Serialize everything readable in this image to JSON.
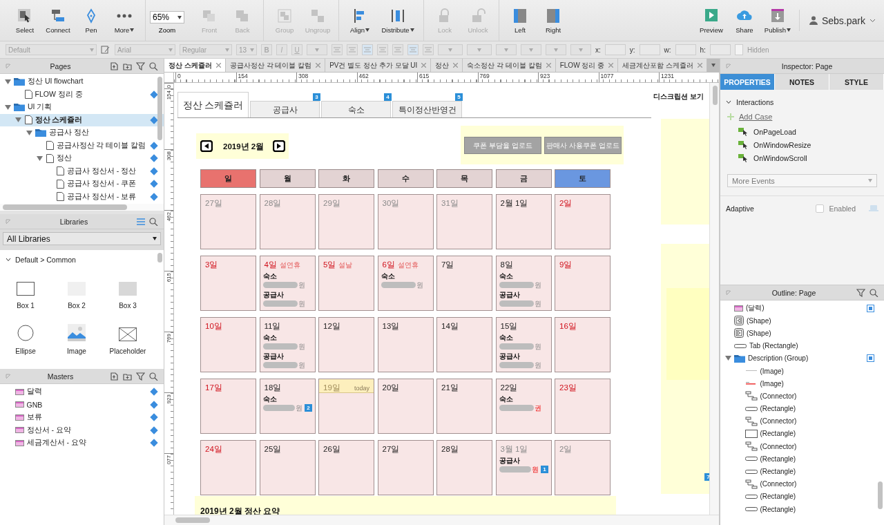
{
  "toolbar": {
    "left": [
      {
        "kind": "select",
        "label": "Select",
        "disabled": false,
        "menu": false
      },
      {
        "kind": "connect",
        "label": "Connect",
        "disabled": false,
        "menu": false
      },
      {
        "kind": "pen",
        "label": "Pen",
        "disabled": false,
        "menu": false
      },
      {
        "kind": "more",
        "label": "More",
        "disabled": false,
        "menu": true
      }
    ],
    "zoom": {
      "label": "Zoom",
      "value": "65%"
    },
    "middle": [
      {
        "kind": "front",
        "label": "Front",
        "disabled": true,
        "menu": false
      },
      {
        "kind": "back",
        "label": "Back",
        "disabled": true,
        "menu": false
      },
      {
        "kind": "group",
        "label": "Group",
        "disabled": true,
        "menu": false
      },
      {
        "kind": "ungroup",
        "label": "Ungroup",
        "disabled": true,
        "menu": false
      },
      {
        "kind": "align",
        "label": "Align",
        "disabled": false,
        "menu": true
      },
      {
        "kind": "distribute",
        "label": "Distribute",
        "disabled": false,
        "menu": true
      },
      {
        "kind": "lock",
        "label": "Lock",
        "disabled": true,
        "menu": false
      },
      {
        "kind": "unlock",
        "label": "Unlock",
        "disabled": true,
        "menu": false
      },
      {
        "kind": "left",
        "label": "Left",
        "disabled": false,
        "menu": false
      },
      {
        "kind": "right",
        "label": "Right",
        "disabled": false,
        "menu": false
      }
    ],
    "right": [
      {
        "kind": "preview",
        "label": "Preview",
        "disabled": false,
        "menu": false
      },
      {
        "kind": "share",
        "label": "Share",
        "disabled": false,
        "menu": false
      },
      {
        "kind": "publish",
        "label": "Publish",
        "disabled": false,
        "menu": true
      }
    ],
    "user": "Sebs.park"
  },
  "format_bar": {
    "style": "Default",
    "font": "Arial",
    "weight": "Regular",
    "size": "13",
    "marks": [
      "B",
      "I",
      "U"
    ],
    "coords": [
      "x:",
      "y:",
      "w:",
      "h:"
    ],
    "hidden": {
      "label": "Hidden",
      "checked": false
    }
  },
  "pages": {
    "title": "Pages",
    "items": [
      {
        "label": "정산 UI flowchart",
        "kind": "folder",
        "selected": false,
        "annotated": false,
        "expanded": true,
        "children": [
          {
            "label": "FLOW 정리 중",
            "kind": "page",
            "selected": false,
            "annotated": true
          }
        ]
      },
      {
        "label": "UI 기획",
        "kind": "folder",
        "selected": false,
        "annotated": false,
        "expanded": true,
        "children": [
          {
            "label": "정산 스케쥴러",
            "kind": "page",
            "selected": true,
            "annotated": true,
            "expanded": true,
            "children": [
              {
                "label": "공급사 정산",
                "kind": "folder",
                "selected": false,
                "annotated": false,
                "expanded": true,
                "children": [
                  {
                    "label": "공급사정산 각 테이블 칼럼",
                    "kind": "page",
                    "selected": false,
                    "annotated": true
                  },
                  {
                    "label": "정산",
                    "kind": "page",
                    "selected": false,
                    "annotated": true,
                    "expanded": true,
                    "children": [
                      {
                        "label": "공급사 정산서 - 정산",
                        "kind": "page",
                        "selected": false,
                        "annotated": true
                      },
                      {
                        "label": "공급사 정산서 - 쿠폰",
                        "kind": "page",
                        "selected": false,
                        "annotated": true
                      },
                      {
                        "label": "공급사 정산서 - 보류",
                        "kind": "page",
                        "selected": false,
                        "annotated": true
                      }
                    ]
                  }
                ]
              }
            ]
          }
        ]
      }
    ]
  },
  "libraries": {
    "title": "Libraries",
    "filter": "All Libraries",
    "section": "Default > Common",
    "widgets": [
      {
        "kind": "box1",
        "label": "Box 1"
      },
      {
        "kind": "box2",
        "label": "Box 2"
      },
      {
        "kind": "box3",
        "label": "Box 3"
      },
      {
        "kind": "ellipse",
        "label": "Ellipse"
      },
      {
        "kind": "image",
        "label": "Image"
      },
      {
        "kind": "placeholder",
        "label": "Placeholder"
      }
    ]
  },
  "masters": {
    "title": "Masters",
    "items": [
      {
        "label": "달력",
        "annotated": true
      },
      {
        "label": "GNB",
        "annotated": true
      },
      {
        "label": "보류",
        "annotated": true
      },
      {
        "label": "정산서 - 요약",
        "annotated": true
      },
      {
        "label": "세금계산서 - 요약",
        "annotated": true
      }
    ]
  },
  "doc_tabs": [
    {
      "label": "정산 스케쥴러",
      "selected": true
    },
    {
      "label": "공급사정산 각 테이블 칼럼",
      "selected": false
    },
    {
      "label": "PV건 별도 정산 추가 모달 UI",
      "selected": false
    },
    {
      "label": "정산",
      "selected": false
    },
    {
      "label": "숙소정산 각 테이블 칼럼",
      "selected": false
    },
    {
      "label": "FLOW 정리 중",
      "selected": false
    },
    {
      "label": "세금계산포함 스케쥴러",
      "selected": false
    }
  ],
  "ruler": {
    "horizontal": [
      "0",
      "154",
      "308",
      "462",
      "615",
      "769",
      "923",
      "1077",
      "1231"
    ],
    "vertical": [
      "0",
      "154",
      "308",
      "462",
      "615",
      "769",
      "923",
      "077"
    ]
  },
  "page": {
    "tabs": [
      {
        "label": "정산 스케쥴러",
        "selected": true
      },
      {
        "label": "공급사",
        "selected": false,
        "badge": "3"
      },
      {
        "label": "숙소",
        "selected": false,
        "badge": "4"
      },
      {
        "label": "특이정산반영건",
        "selected": false,
        "badge": "5"
      }
    ],
    "description_toggle": "디스크립션 보기",
    "month": "2019년 2월",
    "uploads": [
      "쿠폰 부담율 업로드",
      "판매사 사용쿠폰 업로드"
    ],
    "weekdays": [
      {
        "label": "일",
        "color": "#e8726e"
      },
      {
        "label": "월",
        "color": "#e3d3d3"
      },
      {
        "label": "화",
        "color": "#e3d3d3"
      },
      {
        "label": "수",
        "color": "#e3d3d3"
      },
      {
        "label": "목",
        "color": "#e3d3d3"
      },
      {
        "label": "금",
        "color": "#e3d3d3"
      },
      {
        "label": "토",
        "color": "#6a97e0"
      }
    ],
    "weeks": [
      [
        {
          "label": "27일",
          "kind": "muted"
        },
        {
          "label": "28일",
          "kind": "muted"
        },
        {
          "label": "29일",
          "kind": "muted"
        },
        {
          "label": "30일",
          "kind": "muted"
        },
        {
          "label": "31일",
          "kind": "muted"
        },
        {
          "label": "2월 1일",
          "kind": "normal"
        },
        {
          "label": "2일",
          "kind": "holiday"
        }
      ],
      [
        {
          "label": "3일",
          "kind": "holiday"
        },
        {
          "label": "4일",
          "kind": "holiday",
          "note": "설연휴",
          "entries": [
            {
              "label": "숙소",
              "unit": "원",
              "alert": false
            },
            {
              "label": "공급사",
              "unit": "원",
              "alert": false
            }
          ]
        },
        {
          "label": "5일",
          "kind": "holiday",
          "note": "설날"
        },
        {
          "label": "6일",
          "kind": "holiday",
          "note": "설연휴",
          "entries": [
            {
              "label": "숙소",
              "unit": "원",
              "alert": false
            }
          ]
        },
        {
          "label": "7일",
          "kind": "normal"
        },
        {
          "label": "8일",
          "kind": "normal",
          "entries": [
            {
              "label": "숙소",
              "unit": "원",
              "alert": false
            },
            {
              "label": "공급사",
              "unit": "원",
              "alert": false
            }
          ]
        },
        {
          "label": "9일",
          "kind": "holiday"
        }
      ],
      [
        {
          "label": "10일",
          "kind": "holiday"
        },
        {
          "label": "11일",
          "kind": "normal",
          "entries": [
            {
              "label": "숙소",
              "unit": "원",
              "alert": false
            },
            {
              "label": "공급사",
              "unit": "원",
              "alert": false
            }
          ]
        },
        {
          "label": "12일",
          "kind": "normal"
        },
        {
          "label": "13일",
          "kind": "normal"
        },
        {
          "label": "14일",
          "kind": "normal"
        },
        {
          "label": "15일",
          "kind": "normal",
          "entries": [
            {
              "label": "숙소",
              "unit": "원",
              "alert": false
            },
            {
              "label": "공급사",
              "unit": "원",
              "alert": false
            }
          ]
        },
        {
          "label": "16일",
          "kind": "holiday"
        }
      ],
      [
        {
          "label": "17일",
          "kind": "holiday"
        },
        {
          "label": "18일",
          "kind": "normal",
          "badge": "2",
          "entries": [
            {
              "label": "숙소",
              "unit": "원",
              "alert": false
            }
          ]
        },
        {
          "label": "19일",
          "kind": "today",
          "tag": "today"
        },
        {
          "label": "20일",
          "kind": "normal"
        },
        {
          "label": "21일",
          "kind": "normal"
        },
        {
          "label": "22일",
          "kind": "normal",
          "entries": [
            {
              "label": "숙소",
              "unit": "권",
              "alert": true
            }
          ]
        },
        {
          "label": "23일",
          "kind": "holiday"
        }
      ],
      [
        {
          "label": "24일",
          "kind": "holiday"
        },
        {
          "label": "25일",
          "kind": "normal"
        },
        {
          "label": "26일",
          "kind": "normal"
        },
        {
          "label": "27일",
          "kind": "normal"
        },
        {
          "label": "28일",
          "kind": "normal"
        },
        {
          "label": "3월 1일",
          "kind": "muted",
          "badge": "1",
          "entries": [
            {
              "label": "공급사",
              "unit": "원",
              "alert": true
            }
          ]
        },
        {
          "label": "2일",
          "kind": "muted"
        }
      ]
    ],
    "side_badge": "7",
    "summary": "2019년 2월 정산 요약"
  },
  "inspector": {
    "title": "Inspector: Page",
    "tabs": [
      {
        "label": "PROPERTIES",
        "selected": true
      },
      {
        "label": "NOTES",
        "selected": false
      },
      {
        "label": "STYLE",
        "selected": false
      }
    ],
    "section": "Interactions",
    "add_case": "Add Case",
    "events": [
      "OnPageLoad",
      "OnWindowResize",
      "OnWindowScroll"
    ],
    "more_events": "More Events",
    "adaptive": "Adaptive",
    "enabled": {
      "label": "Enabled",
      "checked": false
    }
  },
  "outline": {
    "title": "Outline: Page",
    "items": [
      {
        "label": "(달력)",
        "kind": "master",
        "flagged": true
      },
      {
        "label": "(Shape)",
        "kind": "shape-prev",
        "flagged": false
      },
      {
        "label": "(Shape)",
        "kind": "shape-next",
        "flagged": false
      },
      {
        "label": "Tab (Rectangle)",
        "kind": "bar",
        "flagged": false
      },
      {
        "label": "Description (Group)",
        "kind": "group",
        "flagged": true,
        "expanded": true,
        "children": [
          {
            "label": "(Image)",
            "kind": "image",
            "flagged": false
          },
          {
            "label": "(Image)",
            "kind": "image-red",
            "flagged": false
          },
          {
            "label": "(Connector)",
            "kind": "connector",
            "flagged": false
          },
          {
            "label": "(Rectangle)",
            "kind": "bar",
            "flagged": false
          },
          {
            "label": "(Connector)",
            "kind": "connector",
            "flagged": false
          },
          {
            "label": "(Rectangle)",
            "kind": "box",
            "flagged": false
          },
          {
            "label": "(Connector)",
            "kind": "connector",
            "flagged": false
          },
          {
            "label": "(Rectangle)",
            "kind": "bar",
            "flagged": false
          },
          {
            "label": "(Rectangle)",
            "kind": "bar",
            "flagged": false
          },
          {
            "label": "(Connector)",
            "kind": "connector",
            "flagged": false
          },
          {
            "label": "(Rectangle)",
            "kind": "bar",
            "flagged": false
          },
          {
            "label": "(Rectangle)",
            "kind": "bar",
            "flagged": false
          }
        ]
      }
    ]
  }
}
